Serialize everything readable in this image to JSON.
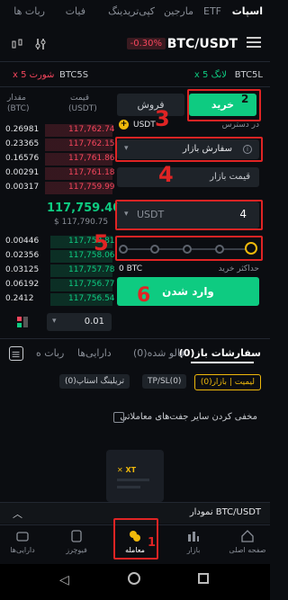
{
  "top_nav": [
    "اسپات",
    "ETF",
    "مارجین",
    "کپی‌تریدینگ",
    "فیات",
    "ربات ها"
  ],
  "header": {
    "pair": "BTC/USDT",
    "change": "-0.30%"
  },
  "leveraged": {
    "long": "x 5 لانگ",
    "btc5l": "BTC5L",
    "short": "x 5 شورت",
    "btc5s": "BTC5S"
  },
  "trade_tabs": {
    "sell": "فروش",
    "buy": "خرید"
  },
  "available": {
    "label": "در دسترس",
    "value": "USDT -"
  },
  "order_type": "سفارش بازار",
  "market_price": "قیمت بازار",
  "amount": {
    "unit": "USDT",
    "value": "4"
  },
  "min_buy": {
    "label": "حداکثر خرید",
    "value": "0 BTC"
  },
  "submit": "وارد شدن",
  "orderbook": {
    "header_price": "قیمت",
    "header_price_unit": "(USDT)",
    "header_qty": "مقدار",
    "header_qty_unit": "(BTC)",
    "asks": [
      {
        "p": "117,762.74",
        "q": "0.26981"
      },
      {
        "p": "117,762.15",
        "q": "0.23365"
      },
      {
        "p": "117,761.86",
        "q": "0.16576"
      },
      {
        "p": "117,761.18",
        "q": "0.00291"
      },
      {
        "p": "117,759.99",
        "q": "0.00317"
      }
    ],
    "last": "117,759.40",
    "last_usd": "$ 117,790.75",
    "bids": [
      {
        "p": "117,758.81",
        "q": "0.00446"
      },
      {
        "p": "117,758.06",
        "q": "0.02356"
      },
      {
        "p": "117,757.78",
        "q": "0.03125"
      },
      {
        "p": "117,756.77",
        "q": "0.06192"
      },
      {
        "p": "117,756.54",
        "q": "0.2412"
      }
    ],
    "tick": "0.01"
  },
  "bottom_tabs": {
    "open": "سفارشات باز(0)",
    "follow": "فالو شده(0)",
    "assets": "دارایی‌ها",
    "bots": "ربات ه"
  },
  "filters": {
    "limit": "لیمیت | بازار(0)",
    "tpsl": "TP/SL(0)",
    "trailing": "تریلینگ استاپ(0)"
  },
  "hide_pairs": "مخفی کردن سایر جفت‌های معاملاتی",
  "chart_bar": "نمودار BTC/USDT",
  "nav": [
    {
      "label": "صفحه اصلی"
    },
    {
      "label": "بازار"
    },
    {
      "label": "معامله"
    },
    {
      "label": "فیوچرز"
    },
    {
      "label": "دارایی‌ها"
    }
  ],
  "annotations": [
    "1",
    "2",
    "3",
    "4",
    "5",
    "6"
  ],
  "colors": {
    "buy": "#0ecb81",
    "sell": "#f6465d",
    "annot": "#e02424",
    "accent": "#f0b90b"
  }
}
